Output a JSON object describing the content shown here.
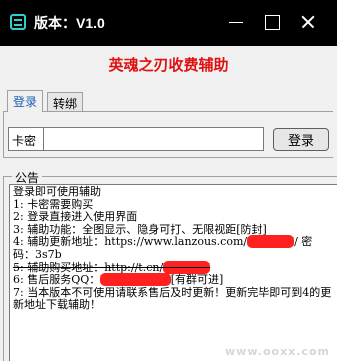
{
  "window": {
    "title": "版本：V1.0",
    "icon": "app-logo-icon",
    "controls": [
      "minimize-icon",
      "maximize-icon",
      "close-icon"
    ]
  },
  "headline": "英魂之刃收费辅助",
  "tabs": [
    {
      "label": "登录",
      "active": true
    },
    {
      "label": "转绑",
      "active": false
    }
  ],
  "login": {
    "key_label": "卡密",
    "key_value": "",
    "button_label": "登录"
  },
  "notice": {
    "legend": "公告",
    "lines": [
      {
        "parts": [
          "登录即可使用辅助"
        ]
      },
      {
        "parts": [
          "1: 卡密需要购买"
        ]
      },
      {
        "parts": [
          "2: 登录直接进入使用界面"
        ]
      },
      {
        "parts": [
          "3: 辅助功能：全图显示、隐身可打、无限视距[防封]"
        ]
      },
      {
        "parts": [
          "4: 辅助更新地址：https://www.lanzous.com/",
          "XXXXXX",
          "/ 密码：3s7b"
        ]
      },
      {
        "parts": [
          "5: 辅助购买地址：http://t.cn/",
          "XXXXXX"
        ]
      },
      {
        "parts": [
          "6: 售后服务QQ：",
          "XXXXXXXXX",
          "[有群可进]"
        ]
      },
      {
        "parts": [
          "7: 当本版本不可使用请联系售后及时更新！更新完毕即可到4的更新地址下载辅助！"
        ]
      }
    ]
  },
  "watermark": "www.ooxx.com",
  "colors": {
    "titlebar_bg": "#000000",
    "headline": "#e01010",
    "active_tab": "#1a5fb4",
    "redaction": "#ff2020"
  }
}
